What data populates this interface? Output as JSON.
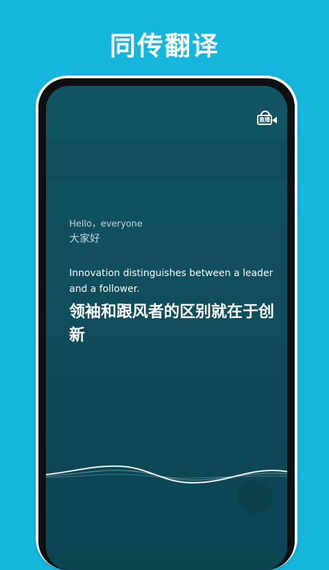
{
  "headline": "同传翻译",
  "live_button": {
    "label": "直播",
    "icon": "live-stream-camera-icon"
  },
  "captions": {
    "previous": {
      "source": "Hello，everyone",
      "translation": "大家好"
    },
    "current": {
      "source": "Innovation distinguishes between a leader and a follower.",
      "translation": "领袖和跟风者的区别就在于创新"
    }
  },
  "colors": {
    "background": "#15b8dc",
    "screen": "#125563",
    "text": "#ffffff"
  }
}
